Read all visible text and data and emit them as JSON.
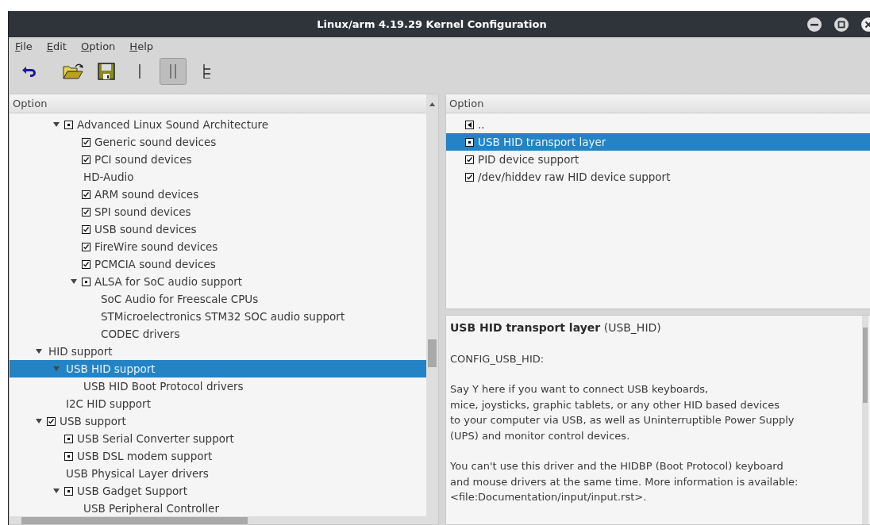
{
  "window": {
    "title": "Linux/arm 4.19.29 Kernel Configuration"
  },
  "menu": [
    "File",
    "Edit",
    "Option",
    "Help"
  ],
  "actions": [
    {
      "kind": "undo"
    },
    {
      "kind": "open"
    },
    {
      "kind": "save"
    }
  ],
  "views": [
    {
      "kind": "single",
      "selected": false
    },
    {
      "kind": "split",
      "selected": true
    },
    {
      "kind": "full",
      "selected": false
    }
  ],
  "tree_panel": {
    "header": "Option",
    "rows": [
      {
        "children": [
          {
            "label": "Advanced Linux Sound Architecture",
            "kind": "module",
            "expanded": true,
            "selected": false,
            "children": [
              {
                "label": "Generic sound devices",
                "kind": "builtin",
                "selected": false
              },
              {
                "label": "PCI sound devices",
                "kind": "builtin",
                "selected": false
              },
              {
                "label": "HD-Audio",
                "selected": false
              },
              {
                "label": "ARM sound devices",
                "kind": "builtin",
                "selected": false
              },
              {
                "label": "SPI sound devices",
                "kind": "builtin",
                "selected": false
              },
              {
                "label": "USB sound devices",
                "kind": "builtin",
                "selected": false
              },
              {
                "label": "FireWire sound devices",
                "kind": "builtin",
                "selected": false
              },
              {
                "label": "PCMCIA sound devices",
                "kind": "builtin",
                "selected": false
              },
              {
                "label": "ALSA for SoC audio support",
                "kind": "module",
                "expanded": true,
                "selected": false,
                "children": [
                  {
                    "label": "SoC Audio for Freescale CPUs",
                    "selected": false
                  },
                  {
                    "label": "STMicroelectronics STM32 SOC audio support",
                    "selected": false
                  },
                  {
                    "label": "CODEC drivers",
                    "selected": false
                  }
                ]
              }
            ]
          }
        ]
      },
      {
        "label": "HID support",
        "expanded": true,
        "selected": false,
        "children": [
          {
            "label": "USB HID support",
            "expanded": true,
            "selected": true,
            "children": [
              {
                "label": "USB HID Boot Protocol drivers",
                "selected": false
              }
            ]
          },
          {
            "label": "I2C HID support",
            "selected": false
          }
        ]
      },
      {
        "label": "USB support",
        "kind": "builtin",
        "expanded": true,
        "selected": false,
        "children": [
          {
            "label": "USB Serial Converter support",
            "kind": "module",
            "selected": false
          },
          {
            "label": "USB DSL modem support",
            "kind": "module",
            "selected": false
          },
          {
            "label": "USB Physical Layer drivers",
            "selected": false
          },
          {
            "label": "USB Gadget Support",
            "kind": "module",
            "expanded": true,
            "selected": false,
            "children": [
              {
                "label": "USB Peripheral Controller",
                "selected": false
              }
            ]
          }
        ]
      }
    ]
  },
  "list_panel": {
    "header": "Option",
    "rows": [
      {
        "label": "..",
        "kind": "back",
        "selected": false
      },
      {
        "label": "USB HID transport layer",
        "kind": "module",
        "selected": true
      },
      {
        "label": "PID device support",
        "kind": "builtin",
        "selected": false
      },
      {
        "label": "/dev/hiddev raw HID device support",
        "kind": "builtin",
        "selected": false
      }
    ]
  },
  "info": {
    "title": "**USB HID transport layer** (USB_HID)",
    "config": "CONFIG_USB_HID:",
    "paragraphs": [
      "Say Y here if you want to connect USB keyboards,\nmice, joysticks, graphic tablets, or any other HID based devices\nto your computer via USB, as well as Uninterruptible Power Supply\n(UPS) and monitor control devices.",
      "You can't use this driver and the HIDBP (Boot Protocol) keyboard\nand mouse drivers at the same time. More information is available:\n<file:Documentation/input/input.rst>."
    ]
  }
}
